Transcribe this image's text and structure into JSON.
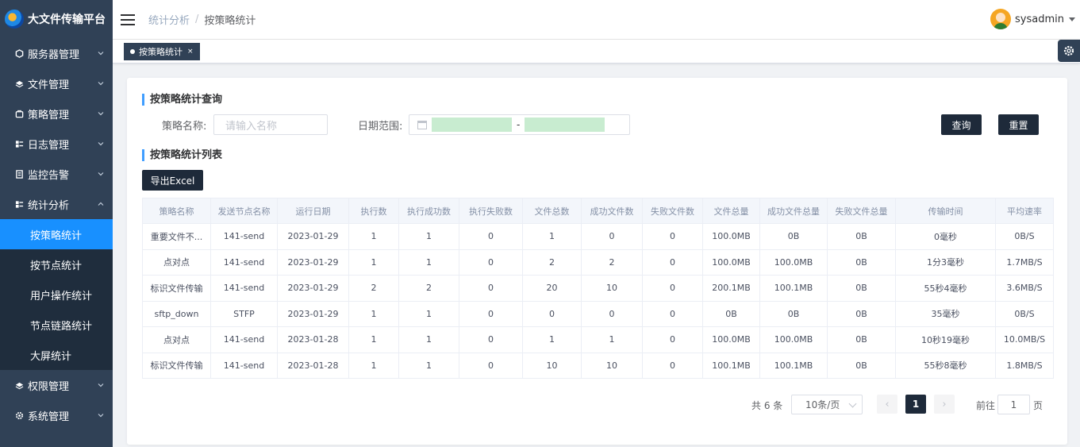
{
  "app": {
    "title": "大文件传输平台"
  },
  "sidebar": {
    "items": [
      {
        "label": "服务器管理"
      },
      {
        "label": "文件管理"
      },
      {
        "label": "策略管理"
      },
      {
        "label": "日志管理"
      },
      {
        "label": "监控告警"
      },
      {
        "label": "统计分析"
      },
      {
        "label": "权限管理"
      },
      {
        "label": "系统管理"
      }
    ],
    "stats_sub": [
      {
        "label": "按策略统计"
      },
      {
        "label": "按节点统计"
      },
      {
        "label": "用户操作统计"
      },
      {
        "label": "节点链路统计"
      },
      {
        "label": "大屏统计"
      }
    ]
  },
  "header": {
    "breadcrumb": [
      "统计分析",
      "按策略统计"
    ],
    "user": "sysadmin"
  },
  "tags": [
    {
      "label": "按策略统计",
      "close": "×"
    }
  ],
  "query": {
    "title": "按策略统计查询",
    "name_label": "策略名称:",
    "name_placeholder": "请输入名称",
    "date_label": "日期范围:",
    "date_sep": "-",
    "search_btn": "查询",
    "reset_btn": "重置"
  },
  "list": {
    "title": "按策略统计列表",
    "export_btn": "导出Excel",
    "columns": [
      "策略名称",
      "发送节点名称",
      "运行日期",
      "执行数",
      "执行成功数",
      "执行失败数",
      "文件总数",
      "成功文件数",
      "失败文件数",
      "文件总量",
      "成功文件总量",
      "失败文件总量",
      "传输时间",
      "平均速率"
    ],
    "rows": [
      [
        "重要文件不...",
        "141-send",
        "2023-01-29",
        "1",
        "1",
        "0",
        "1",
        "0",
        "0",
        "100.0MB",
        "0B",
        "0B",
        "0毫秒",
        "0B/S"
      ],
      [
        "点对点",
        "141-send",
        "2023-01-29",
        "1",
        "1",
        "0",
        "2",
        "2",
        "0",
        "100.0MB",
        "100.0MB",
        "0B",
        "1分3毫秒",
        "1.7MB/S"
      ],
      [
        "标识文件传输",
        "141-send",
        "2023-01-29",
        "2",
        "2",
        "0",
        "20",
        "10",
        "0",
        "200.1MB",
        "100.1MB",
        "0B",
        "55秒4毫秒",
        "3.6MB/S"
      ],
      [
        "sftp_down",
        "STFP",
        "2023-01-29",
        "1",
        "1",
        "0",
        "0",
        "0",
        "0",
        "0B",
        "0B",
        "0B",
        "35毫秒",
        "0B/S"
      ],
      [
        "点对点",
        "141-send",
        "2023-01-28",
        "1",
        "1",
        "0",
        "1",
        "1",
        "0",
        "100.0MB",
        "100.0MB",
        "0B",
        "10秒19毫秒",
        "10.0MB/S"
      ],
      [
        "标识文件传输",
        "141-send",
        "2023-01-28",
        "1",
        "1",
        "0",
        "10",
        "10",
        "0",
        "100.1MB",
        "100.1MB",
        "0B",
        "55秒8毫秒",
        "1.8MB/S"
      ]
    ]
  },
  "pagination": {
    "total": "共 6 条",
    "page_size": "10条/页",
    "prev": "‹",
    "current": "1",
    "next": "›",
    "goto_label": "前往",
    "goto_value": "1",
    "page_unit": "页"
  }
}
